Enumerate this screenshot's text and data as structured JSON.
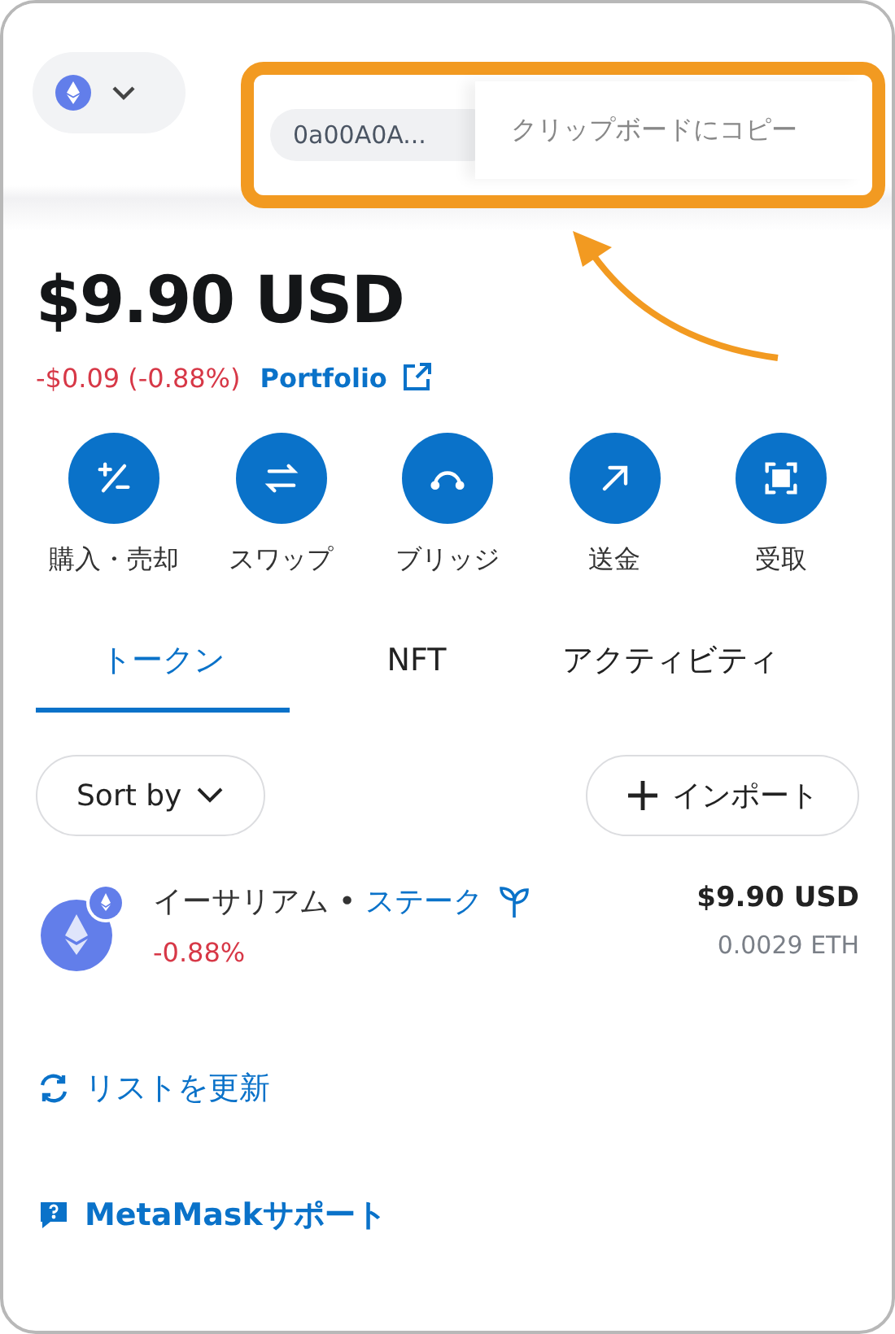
{
  "account": {
    "address": "0a00A0A...",
    "tooltip": "クリップボードにコピー"
  },
  "balance": {
    "amount": "$9.90 USD",
    "change": "-$0.09 (-0.88%)",
    "portfolio_link": "Portfolio"
  },
  "actions": [
    {
      "label": "購入・売却",
      "kind": "buy-sell"
    },
    {
      "label": "スワップ",
      "kind": "swap"
    },
    {
      "label": "ブリッジ",
      "kind": "bridge"
    },
    {
      "label": "送金",
      "kind": "send"
    },
    {
      "label": "受取",
      "kind": "receive"
    }
  ],
  "tabs": [
    {
      "label": "トークン",
      "selected": true
    },
    {
      "label": "NFT",
      "selected": false
    },
    {
      "label": "アクティビティ",
      "selected": false
    }
  ],
  "sort_button": "Sort by",
  "import_button": "インポート",
  "tokens": [
    {
      "name": "イーサリアム",
      "separator": "•",
      "stake_link": "ステーク",
      "change": "-0.88%",
      "fiat": "$9.90 USD",
      "amount": "0.0029 ETH"
    }
  ],
  "refresh_link": "リストを更新",
  "support_link": "MetaMaskサポート"
}
